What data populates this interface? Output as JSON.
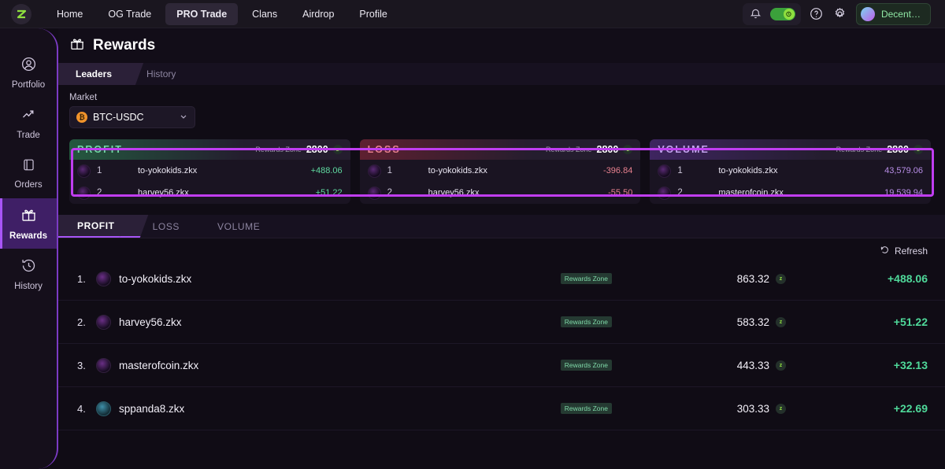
{
  "topnav": {
    "logo_alt": "zkx-logo",
    "links": [
      {
        "label": "Home",
        "active": false
      },
      {
        "label": "OG Trade",
        "active": false
      },
      {
        "label": "PRO Trade",
        "active": true
      },
      {
        "label": "Clans",
        "active": false
      },
      {
        "label": "Airdrop",
        "active": false
      },
      {
        "label": "Profile",
        "active": false
      }
    ],
    "profile_label": "Decent…"
  },
  "sidebar": {
    "items": [
      {
        "label": "Portfolio",
        "icon": "person-circle-icon",
        "active": false
      },
      {
        "label": "Trade",
        "icon": "trend-up-icon",
        "active": false
      },
      {
        "label": "Orders",
        "icon": "book-icon",
        "active": false
      },
      {
        "label": "Rewards",
        "icon": "gift-icon",
        "active": true
      },
      {
        "label": "History",
        "icon": "clock-rewind-icon",
        "active": false
      }
    ]
  },
  "page": {
    "title": "Rewards",
    "tabs": [
      {
        "label": "Leaders",
        "active": true
      },
      {
        "label": "History",
        "active": false
      }
    ],
    "market": {
      "label": "Market",
      "value": "BTC-USDC",
      "token_symbol": "₿"
    }
  },
  "cards": [
    {
      "title": "PROFIT",
      "kind": "profit",
      "rewards_zone_label": "Rewards Zone",
      "rewards_zone_value": "2800",
      "rows": [
        {
          "rank": "1",
          "name": "to-yokokids.zkx",
          "value": "+488.06"
        },
        {
          "rank": "2",
          "name": "harvey56.zkx",
          "value": "+51.22"
        }
      ]
    },
    {
      "title": "LOSS",
      "kind": "loss",
      "rewards_zone_label": "Rewards Zone",
      "rewards_zone_value": "2800",
      "rows": [
        {
          "rank": "1",
          "name": "to-yokokids.zkx",
          "value": "-396.84"
        },
        {
          "rank": "2",
          "name": "harvey56.zkx",
          "value": "-55.50"
        }
      ]
    },
    {
      "title": "VOLUME",
      "kind": "volume",
      "rewards_zone_label": "Rewards Zone",
      "rewards_zone_value": "2800",
      "rows": [
        {
          "rank": "1",
          "name": "to-yokokids.zkx",
          "value": "43,579.06"
        },
        {
          "rank": "2",
          "name": "masterofcoin.zkx",
          "value": "19,539.94"
        }
      ]
    }
  ],
  "subtabs": [
    {
      "label": "PROFIT",
      "active": true
    },
    {
      "label": "LOSS",
      "active": false
    },
    {
      "label": "VOLUME",
      "active": false
    }
  ],
  "refresh_label": "Refresh",
  "leaderboard": {
    "badge_label": "Rewards Zone",
    "rows": [
      {
        "index": "1.",
        "name": "to-yokokids.zkx",
        "badge": "Rewards Zone",
        "score": "863.32",
        "amount": "+488.06"
      },
      {
        "index": "2.",
        "name": "harvey56.zkx",
        "badge": "Rewards Zone",
        "score": "583.32",
        "amount": "+51.22"
      },
      {
        "index": "3.",
        "name": "masterofcoin.zkx",
        "badge": "Rewards Zone",
        "score": "443.33",
        "amount": "+32.13"
      },
      {
        "index": "4.",
        "name": "sppanda8.zkx",
        "badge": "Rewards Zone",
        "score": "303.33",
        "amount": "+22.69"
      }
    ]
  },
  "colors": {
    "accent_purple": "#a855f7",
    "highlight": "#c03df0",
    "positive": "#4fd99a",
    "negative": "#e8818f",
    "volume": "#b98fe8",
    "brand_green": "#8ede3f"
  }
}
